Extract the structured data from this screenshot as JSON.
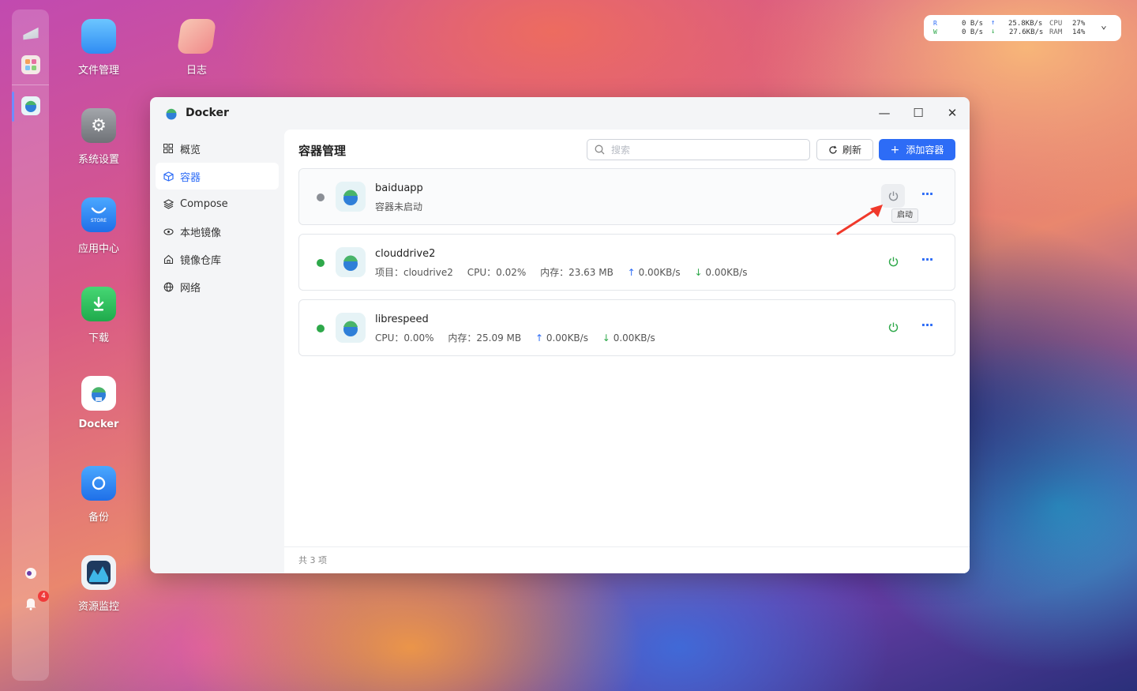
{
  "monitor": {
    "read_label": "R",
    "write_label": "W",
    "read_speed": "0  B/s",
    "write_speed": "0  B/s",
    "upload": "25.8KB/s",
    "download": "27.6KB/s",
    "cpu_label": "CPU",
    "cpu_value": "27%",
    "ram_label": "RAM",
    "ram_value": "14%"
  },
  "dock": {
    "notification_count": "4"
  },
  "desktop": {
    "icons": [
      {
        "label": "文件管理",
        "icon": "folder-icon",
        "color": "#3aa6f5"
      },
      {
        "label": "日志",
        "icon": "log-icon",
        "color": "#f3a98b"
      },
      {
        "label": "系统设置",
        "icon": "gear-icon",
        "color": "#8d8f94"
      },
      {
        "label": "应用中心",
        "icon": "store-icon",
        "color": "#2f8cf3"
      },
      {
        "label": "下载",
        "icon": "download-icon",
        "color": "#2ec45a"
      },
      {
        "label": "Docker",
        "icon": "docker-icon",
        "color": "#ffffff"
      },
      {
        "label": "备份",
        "icon": "backup-icon",
        "color": "#2f8cf3"
      },
      {
        "label": "资源监控",
        "icon": "monitor-icon",
        "color": "#1e3a5f"
      }
    ],
    "store_text": "STORE"
  },
  "window": {
    "title": "Docker",
    "nav": [
      {
        "label": "概览",
        "icon": "grid-icon"
      },
      {
        "label": "容器",
        "icon": "box-icon"
      },
      {
        "label": "Compose",
        "icon": "layers-icon"
      },
      {
        "label": "本地镜像",
        "icon": "image-icon"
      },
      {
        "label": "镜像仓库",
        "icon": "home-icon"
      },
      {
        "label": "网络",
        "icon": "globe-icon"
      }
    ],
    "active_nav": "容器",
    "content_title": "容器管理",
    "search_placeholder": "搜索",
    "refresh_label": "刷新",
    "add_label": "添加容器",
    "containers": [
      {
        "name": "baiduapp",
        "status": "stopped",
        "info": {
          "status_text": "容器未启动"
        }
      },
      {
        "name": "clouddrive2",
        "status": "running",
        "info": {
          "project": "项目：cloudrive2",
          "cpu": "CPU：0.02%",
          "mem": "内存：23.63 MB",
          "up": "0.00KB/s",
          "down": "0.00KB/s"
        }
      },
      {
        "name": "librespeed",
        "status": "running",
        "info": {
          "cpu": "CPU：0.00%",
          "mem": "内存：25.09 MB",
          "up": "0.00KB/s",
          "down": "0.00KB/s"
        }
      }
    ],
    "tooltip": "启动",
    "footer": "共 3 项",
    "colors": {
      "accent": "#2d6cf6",
      "running": "#2ea84a",
      "stopped": "#8b8f96",
      "arrow": "#f0392b"
    }
  }
}
